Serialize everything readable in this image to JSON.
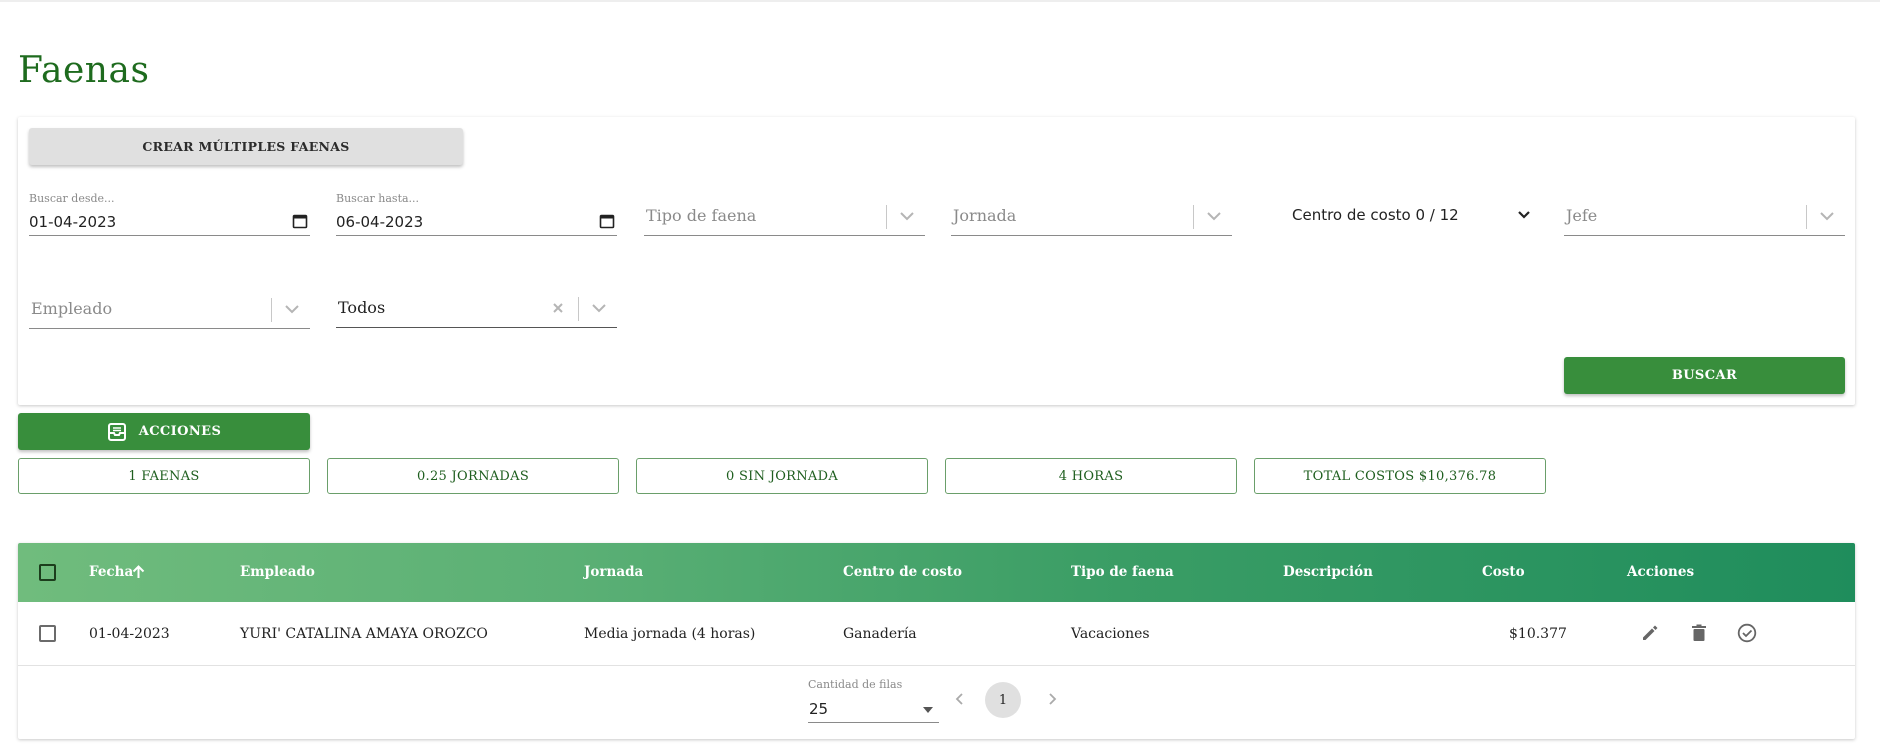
{
  "page": {
    "title": "Faenas"
  },
  "filters": {
    "create_multiple_label": "CREAR MÚLTIPLES FAENAS",
    "date_from": {
      "label": "Buscar desde...",
      "value": "01-04-2023"
    },
    "date_to": {
      "label": "Buscar hasta...",
      "value": "06-04-2023"
    },
    "tipo_faena_placeholder": "Tipo de faena",
    "jornada_placeholder": "Jornada",
    "centro_costo_label": "Centro de costo 0 / 12",
    "jefe_placeholder": "Jefe",
    "empleado_placeholder": "Empleado",
    "estado_value": "Todos",
    "search_label": "BUSCAR"
  },
  "actions": {
    "label": "ACCIONES"
  },
  "stats": [
    {
      "label": "1 FAENAS"
    },
    {
      "label": "0.25 JORNADAS"
    },
    {
      "label": "0 SIN JORNADA"
    },
    {
      "label": "4 HORAS"
    },
    {
      "label": "TOTAL COSTOS $10,376.78"
    }
  ],
  "table": {
    "columns": [
      "Fecha",
      "Empleado",
      "Jornada",
      "Centro de costo",
      "Tipo de faena",
      "Descripción",
      "Costo",
      "Acciones"
    ],
    "sort": {
      "column": "Fecha",
      "direction": "ascending"
    },
    "rows": [
      {
        "fecha": "01-04-2023",
        "empleado": "YURI' CATALINA AMAYA OROZCO",
        "jornada": "Media jornada (4 horas)",
        "centro_costo": "Ganadería",
        "tipo_faena": "Vacaciones",
        "descripcion": "",
        "costo": "$10.377"
      }
    ]
  },
  "pagination": {
    "rows_label": "Cantidad de filas",
    "rows_value": "25",
    "current_page": "1"
  },
  "colors": {
    "primary": "#388e3c",
    "title": "#1e6b1e",
    "header_gradient_start": "#70bc7d",
    "header_gradient_end": "#1f8d5c"
  }
}
